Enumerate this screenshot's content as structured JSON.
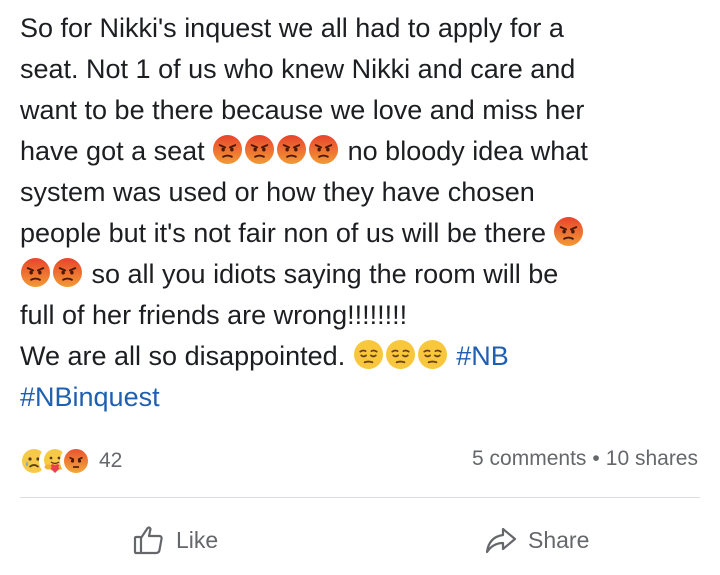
{
  "post": {
    "lines": [
      {
        "parts": [
          {
            "t": "text",
            "v": "So for Nikki's inquest we all had to apply for a"
          }
        ]
      },
      {
        "parts": [
          {
            "t": "text",
            "v": "seat. Not 1 of us who knew Nikki and care and"
          }
        ]
      },
      {
        "parts": [
          {
            "t": "text",
            "v": "want to be there because we love and miss her"
          }
        ]
      },
      {
        "parts": [
          {
            "t": "text",
            "v": "have got a seat "
          },
          {
            "t": "emoji",
            "v": "angry-face-icon"
          },
          {
            "t": "emoji",
            "v": "angry-face-icon"
          },
          {
            "t": "emoji",
            "v": "angry-face-icon"
          },
          {
            "t": "emoji",
            "v": "angry-face-icon"
          },
          {
            "t": "text",
            "v": " no bloody idea what"
          }
        ]
      },
      {
        "parts": [
          {
            "t": "text",
            "v": "system was used or how they have chosen"
          }
        ]
      },
      {
        "parts": [
          {
            "t": "text",
            "v": "people but it's not fair non of us will be there "
          },
          {
            "t": "emoji",
            "v": "angry-face-icon"
          }
        ]
      },
      {
        "parts": [
          {
            "t": "emoji",
            "v": "angry-face-icon"
          },
          {
            "t": "emoji",
            "v": "angry-face-icon"
          },
          {
            "t": "text",
            "v": " so all you idiots saying the room will be"
          }
        ]
      },
      {
        "parts": [
          {
            "t": "text",
            "v": "full of her friends are wrong!!!!!!!!"
          }
        ]
      },
      {
        "parts": [
          {
            "t": "text",
            "v": "We are all so disappointed. "
          },
          {
            "t": "emoji",
            "v": "pensive-face-icon"
          },
          {
            "t": "emoji",
            "v": "pensive-face-icon"
          },
          {
            "t": "emoji",
            "v": "pensive-face-icon"
          },
          {
            "t": "text",
            "v": " "
          },
          {
            "t": "tag",
            "v": "#NB"
          }
        ]
      },
      {
        "parts": [
          {
            "t": "tag",
            "v": "#NBinquest"
          }
        ]
      }
    ],
    "hashtag_color": "#1f5fb0"
  },
  "reactions": {
    "icons": [
      "sad-reaction-icon",
      "care-reaction-icon",
      "angry-reaction-icon"
    ],
    "count": "42"
  },
  "stats": {
    "comments": "5 comments",
    "separator": "•",
    "shares": "10 shares"
  },
  "actions": {
    "like_label": "Like",
    "share_label": "Share"
  }
}
